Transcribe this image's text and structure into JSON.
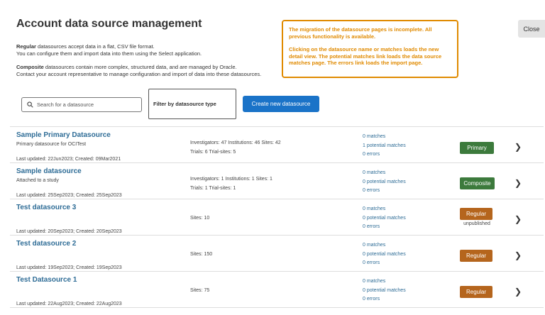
{
  "page": {
    "title": "Account data source management",
    "description_regular": {
      "bold": "Regular",
      "line1_rest": " datasources accept data in a flat, CSV file format.",
      "line2": "You can configure them and import data into them using the Select application."
    },
    "description_composite": {
      "bold": "Composite",
      "line1_rest": " datasources contain more complex, structured data, and are managed by Oracle.",
      "line2": "Contact your account representative to manage configuration and import of data into these datasources."
    },
    "notice": {
      "para1": "The migration of the datasource pages is incomplete. All previous functionality is available.",
      "para2": "Clicking on the datasource name or matches loads the new detail view. The potential matches link loads the data source matches page. The errors link loads the import page."
    },
    "close_label": "Close"
  },
  "toolbar": {
    "search_placeholder": "Search for a datasource",
    "filter_label": "Filter by datasource type",
    "create_label": "Create new datasource"
  },
  "datasources": [
    {
      "name": "Sample Primary Datasource",
      "subtitle": "Primary datasource for OCITest",
      "updated": "Last updated: 22Jun2023; Created: 09Mar2021",
      "stats_line1": "Investigators: 47  Institutions: 46  Sites: 42",
      "stats_line2": "Trials: 6  Trial-sites: 5",
      "matches": "0 matches",
      "potential_matches": "1 potential matches",
      "errors": "0 errors",
      "badge": "Primary",
      "badge_note": ""
    },
    {
      "name": "Sample datasource",
      "subtitle": "Attached to a study",
      "updated": "Last updated: 25Sep2023; Created: 25Sep2023",
      "stats_line1": "Investigators: 1  Institutions: 1  Sites: 1",
      "stats_line2": "Trials: 1  Trial-sites: 1",
      "matches": "0 matches",
      "potential_matches": "0 potential matches",
      "errors": "0 errors",
      "badge": "Composite",
      "badge_note": ""
    },
    {
      "name": "Test datasource 3",
      "subtitle": "",
      "updated": "Last updated: 20Sep2023; Created: 20Sep2023",
      "stats_line1": "Sites: 10",
      "stats_line2": "",
      "matches": "0 matches",
      "potential_matches": "0 potential matches",
      "errors": "0 errors",
      "badge": "Regular",
      "badge_note": "unpublished"
    },
    {
      "name": "Test datasource 2",
      "subtitle": "",
      "updated": "Last updated: 19Sep2023; Created: 19Sep2023",
      "stats_line1": "Sites: 150",
      "stats_line2": "",
      "matches": "0 matches",
      "potential_matches": "0 potential matches",
      "errors": "0 errors",
      "badge": "Regular",
      "badge_note": ""
    },
    {
      "name": "Test Datasource 1",
      "subtitle": "",
      "updated": "Last updated: 22Aug2023; Created: 22Aug2023",
      "stats_line1": "Sites: 75",
      "stats_line2": "",
      "matches": "0 matches",
      "potential_matches": "0 potential matches",
      "errors": "0 errors",
      "badge": "Regular",
      "badge_note": ""
    }
  ],
  "colors": {
    "link": "#2e6c96",
    "primary_badge": "#3c7a3c",
    "composite_badge": "#3c7a3c",
    "regular_badge": "#b5651d",
    "notice": "#e08a00",
    "create_button": "#1a73c8"
  }
}
